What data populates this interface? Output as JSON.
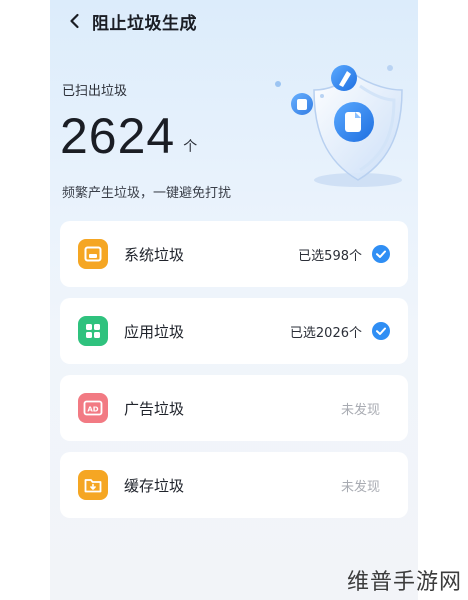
{
  "header": {
    "title": "阻止垃圾生成",
    "back_icon": "chevron-left-icon"
  },
  "summary": {
    "scanned_label": "已扫出垃圾",
    "count": "2624",
    "unit": "个",
    "subtitle": "频繁产生垃圾，一键避免打扰"
  },
  "categories": [
    {
      "label": "系统垃圾",
      "status": "已选598个",
      "selected": true,
      "icon": "system-junk-icon",
      "color": "#f5a623"
    },
    {
      "label": "应用垃圾",
      "status": "已选2026个",
      "selected": true,
      "icon": "app-junk-icon",
      "color": "#2fc27e"
    },
    {
      "label": "广告垃圾",
      "status": "未发现",
      "selected": false,
      "icon": "ad-junk-icon",
      "color": "#f27a83"
    },
    {
      "label": "缓存垃圾",
      "status": "未发现",
      "selected": false,
      "icon": "cache-junk-icon",
      "color": "#f5a623"
    }
  ],
  "watermark": "维普手游网",
  "colors": {
    "accent": "#2f8ef4",
    "title": "#1a1d24"
  }
}
